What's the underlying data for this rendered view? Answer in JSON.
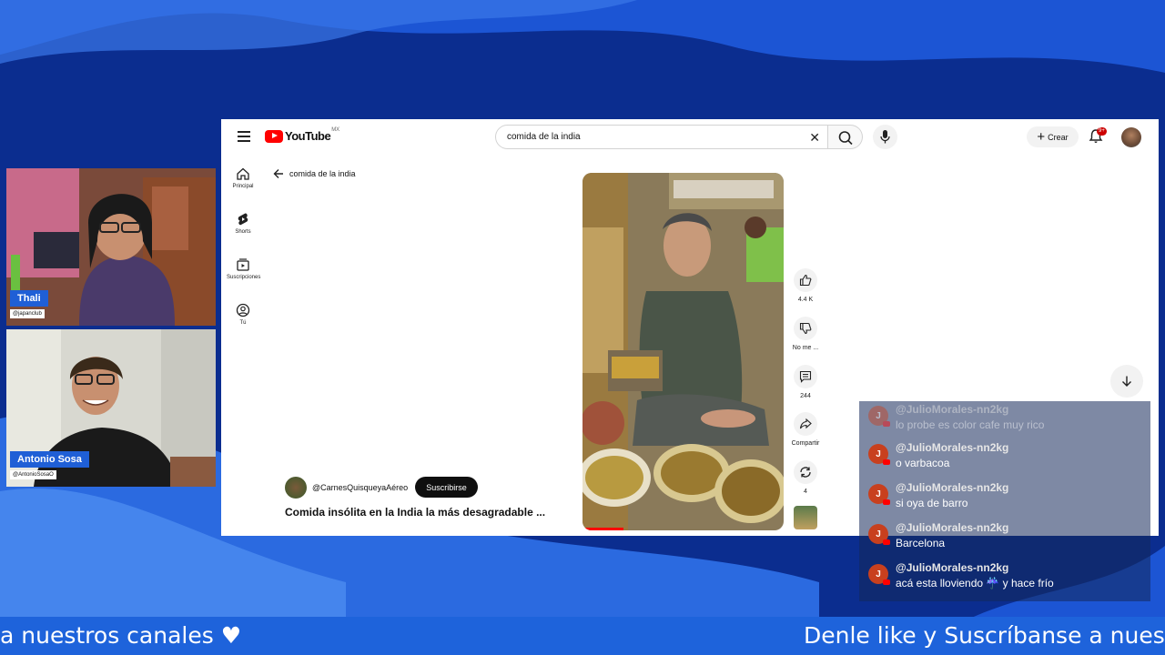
{
  "youtube": {
    "logo_text": "YouTube",
    "logo_country": "MX",
    "search_value": "comida de la india",
    "create_label": "Crear",
    "notification_badge": "9+",
    "sidebar": [
      {
        "label": "Principal",
        "icon": "home-icon"
      },
      {
        "label": "Shorts",
        "icon": "shorts-icon"
      },
      {
        "label": "Suscripciones",
        "icon": "subscriptions-icon"
      },
      {
        "label": "Tú",
        "icon": "you-icon"
      }
    ],
    "back_label": "comida de la india",
    "channel_name": "@CarnesQuisqueyaAéreo",
    "subscribe_label": "Suscribirse",
    "video_title": "Comida insólita en la India la más desagradable ...",
    "actions": {
      "likes": "4.4 K",
      "dislike": "No me ...",
      "comments": "244",
      "share": "Compartir",
      "remix": "4"
    }
  },
  "cams": [
    {
      "name": "Thali",
      "handle": "@japanclub"
    },
    {
      "name": "Antonio Sosa",
      "handle": "@AntonioSosaO"
    }
  ],
  "chat": [
    {
      "initial": "J",
      "user": "@JulioMorales-nn2kg",
      "text": "lo probe es color cafe muy rico"
    },
    {
      "initial": "J",
      "user": "@JulioMorales-nn2kg",
      "text": "o varbacoa"
    },
    {
      "initial": "J",
      "user": "@JulioMorales-nn2kg",
      "text": "si oya de barro"
    },
    {
      "initial": "J",
      "user": "@JulioMorales-nn2kg",
      "text": "Barcelona"
    },
    {
      "initial": "J",
      "user": "@JulioMorales-nn2kg",
      "text": "acá esta lloviendo ☔ y hace frío"
    }
  ],
  "ticker": {
    "left_text": "a nuestros canales ♥",
    "right_text": "Denle like y Suscríbanse a nuestro"
  },
  "colors": {
    "background": "#0a2f9c",
    "accent": "#1e63db",
    "youtube_red": "#ff0000"
  }
}
